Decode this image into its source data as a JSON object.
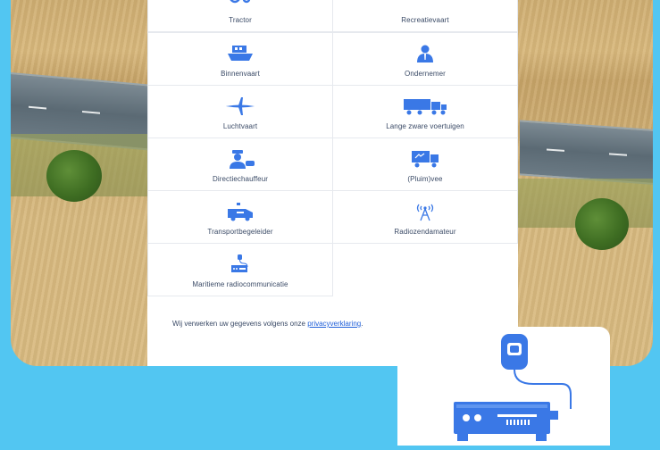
{
  "colors": {
    "background": "#52c6f2",
    "icon_blue": "#3a78e6",
    "text": "#3a4a66",
    "link": "#1f5fd9"
  },
  "categories": [
    {
      "label": "Tractor",
      "icon": "tractor-icon"
    },
    {
      "label": "Recreatievaart",
      "icon": "recreational-boat-icon"
    },
    {
      "label": "Binnenvaart",
      "icon": "inland-ship-icon"
    },
    {
      "label": "Ondernemer",
      "icon": "entrepreneur-icon"
    },
    {
      "label": "Luchtvaart",
      "icon": "airplane-icon"
    },
    {
      "label": "Lange zware voertuigen",
      "icon": "long-heavy-vehicle-icon"
    },
    {
      "label": "Directiechauffeur",
      "icon": "chauffeur-icon"
    },
    {
      "label": "(Pluim)vee",
      "icon": "livestock-truck-icon"
    },
    {
      "label": "Transportbegeleider",
      "icon": "escort-vehicle-icon"
    },
    {
      "label": "Radiozendamateur",
      "icon": "radio-antenna-icon"
    },
    {
      "label": "Maritieme radiocommunicatie",
      "icon": "maritime-radio-icon"
    }
  ],
  "privacy": {
    "text": "Wij verwerken uw gegevens volgens onze",
    "link": "privacyverklaring",
    "end": "."
  },
  "feature_card": {
    "icon": "maritime-radio-icon"
  }
}
